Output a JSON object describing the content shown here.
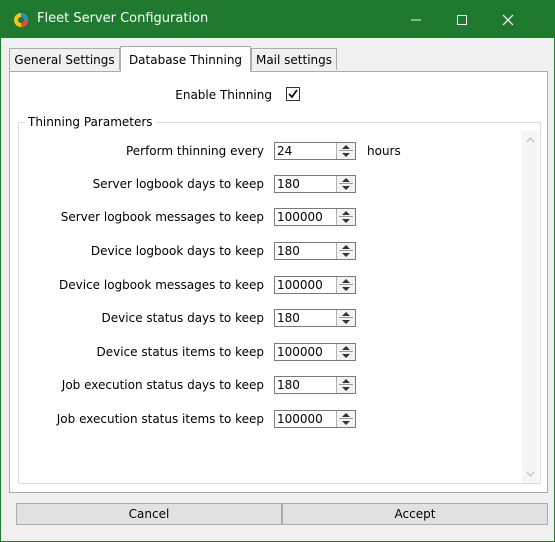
{
  "window": {
    "title": "Fleet Server Configuration",
    "accent": "#1f7a30"
  },
  "tabs": [
    {
      "label": "General Settings"
    },
    {
      "label": "Database Thinning"
    },
    {
      "label": "Mail settings"
    }
  ],
  "thinning": {
    "enable_label": "Enable Thinning",
    "enabled": true,
    "group_title": "Thinning Parameters",
    "params": [
      {
        "label": "Perform thinning every",
        "value": "24",
        "unit": "hours"
      },
      {
        "label": "Server logbook days to keep",
        "value": "180"
      },
      {
        "label": "Server logbook messages to keep",
        "value": "100000"
      },
      {
        "label": "Device logbook days to keep",
        "value": "180"
      },
      {
        "label": "Device logbook messages to keep",
        "value": "100000"
      },
      {
        "label": "Device status days to keep",
        "value": "180"
      },
      {
        "label": "Device status items to keep",
        "value": "100000"
      },
      {
        "label": "Job execution status days to keep",
        "value": "180"
      },
      {
        "label": "Job execution status items to keep",
        "value": "100000"
      }
    ]
  },
  "buttons": {
    "cancel": "Cancel",
    "accept": "Accept"
  }
}
